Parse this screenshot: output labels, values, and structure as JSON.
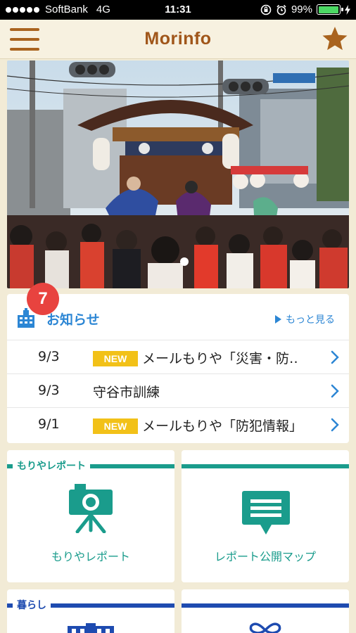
{
  "status_bar": {
    "carrier": "SoftBank",
    "network": "4G",
    "time": "11:31",
    "battery": "99%",
    "battery_level": 0.99
  },
  "nav": {
    "title": "Morinfo",
    "menu_icon": "hamburger-menu-icon",
    "favorite_icon": "star-icon"
  },
  "banner": {
    "page_count": 1,
    "current_page": 1
  },
  "notice_badge": "7",
  "news": {
    "title": "お知らせ",
    "more_label": "もっと見る",
    "items": [
      {
        "date": "9/3",
        "new": true,
        "new_label": "NEW",
        "text": "メールもりや「災害・防‥"
      },
      {
        "date": "9/3",
        "new": false,
        "new_label": "",
        "text": "守谷市訓練"
      },
      {
        "date": "9/1",
        "new": true,
        "new_label": "NEW",
        "text": "メールもりや「防犯情報」"
      }
    ]
  },
  "tiles": {
    "report": {
      "section_label": "もりやレポート",
      "label": "もりやレポート",
      "icon": "camera-tripod-icon"
    },
    "map": {
      "section_label": "",
      "label": "レポート公開マップ",
      "icon": "speech-bubble-icon"
    },
    "living": {
      "section_label": "暮らし",
      "icon": "building-icon"
    },
    "other": {
      "section_label": "",
      "icon": "butterfly-icon"
    }
  },
  "colors": {
    "brand_brown": "#a0561a",
    "accent_blue": "#2c86d4",
    "teal": "#1a9c8c",
    "navy": "#1e4bb0",
    "badge_red": "#e8433f",
    "new_yellow": "#f2c118"
  }
}
